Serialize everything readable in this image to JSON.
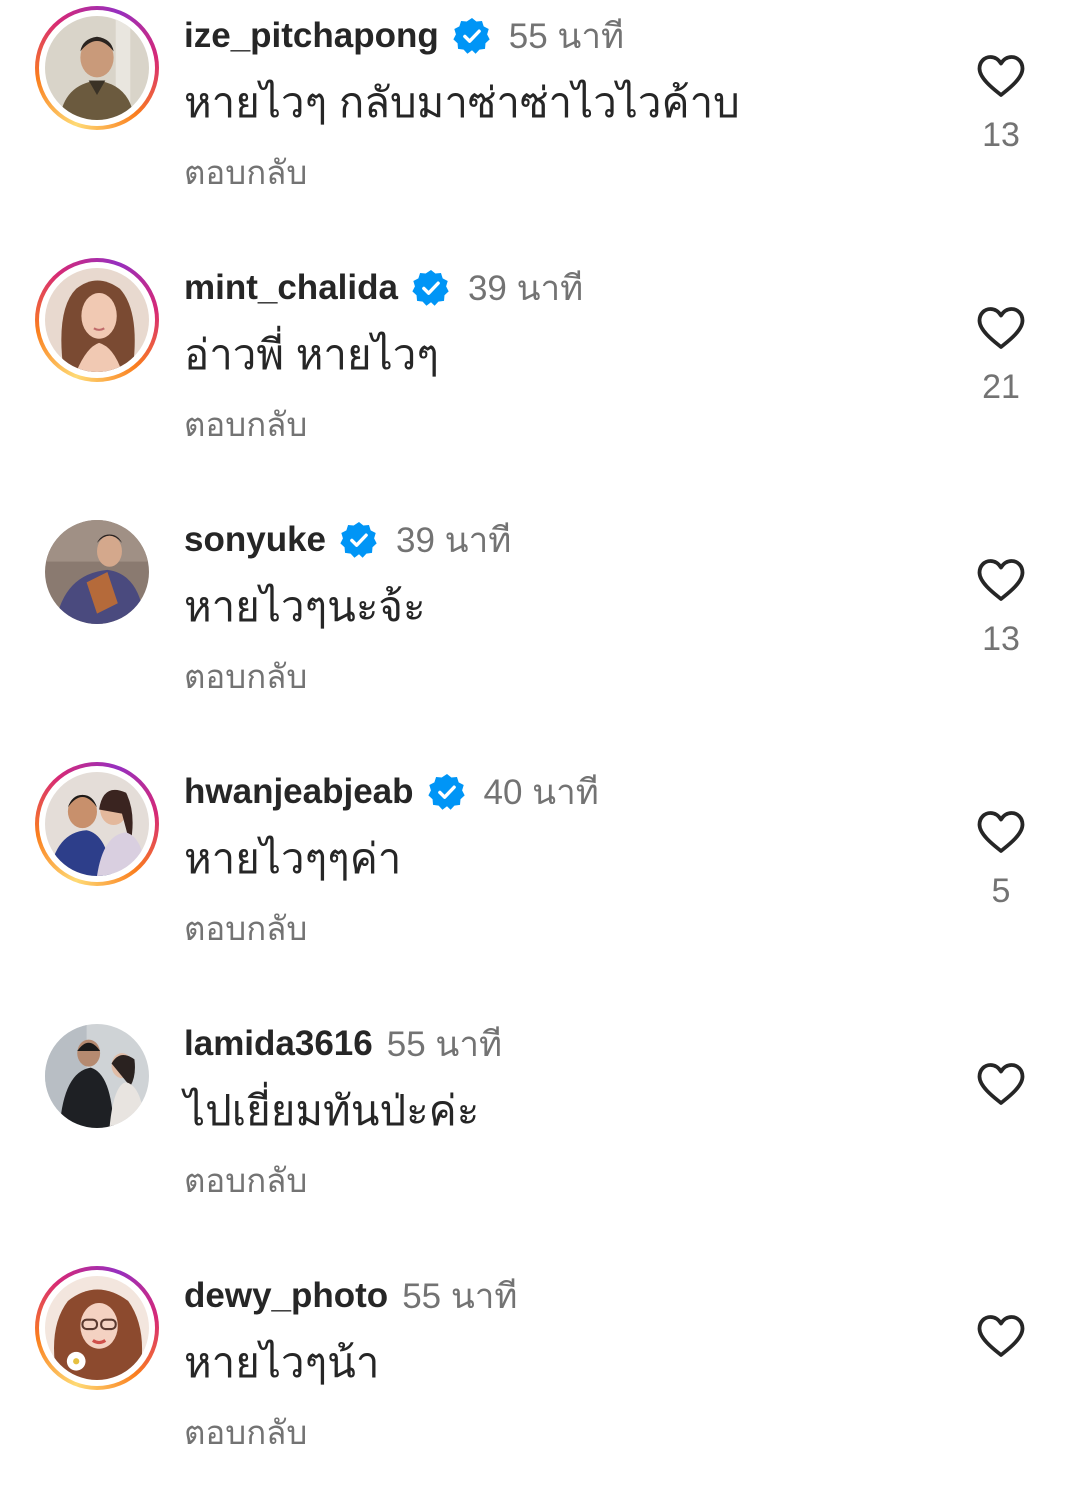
{
  "colors": {
    "text_primary": "#262626",
    "text_secondary": "#737373",
    "verified_blue": "#0095F6",
    "story_ring": [
      "#feda75",
      "#fa7e1e",
      "#d62976",
      "#962fbf"
    ]
  },
  "icons": {
    "verified": "verified-badge-icon",
    "like": "heart-outline-icon"
  },
  "comments": [
    {
      "username": "ize_pitchapong",
      "verified": true,
      "story_ring": true,
      "time": "55 นาที",
      "text": "หายไวๆ กลับมาซ่าซ่าไวไวค้าบ",
      "reply_label": "ตอบกลับ",
      "likes": "13"
    },
    {
      "username": "mint_chalida",
      "verified": true,
      "story_ring": true,
      "time": "39 นาที",
      "text": "อ่าวพี่ หายไวๆ",
      "reply_label": "ตอบกลับ",
      "likes": "21"
    },
    {
      "username": "sonyuke",
      "verified": true,
      "story_ring": false,
      "time": "39 นาที",
      "text": "หายไวๆนะจ้ะ",
      "reply_label": "ตอบกลับ",
      "likes": "13"
    },
    {
      "username": "hwanjeabjeab",
      "verified": true,
      "story_ring": true,
      "time": "40 นาที",
      "text": "หายไวๆๆค่า",
      "reply_label": "ตอบกลับ",
      "likes": "5"
    },
    {
      "username": "lamida3616",
      "verified": false,
      "story_ring": false,
      "time": "55 นาที",
      "text": "ไปเยี่ยมทันป่ะค่ะ",
      "reply_label": "ตอบกลับ",
      "likes": ""
    },
    {
      "username": "dewy_photo",
      "verified": false,
      "story_ring": true,
      "time": "55 นาที",
      "text": "หายไวๆน้า",
      "reply_label": "ตอบกลับ",
      "likes": ""
    }
  ]
}
